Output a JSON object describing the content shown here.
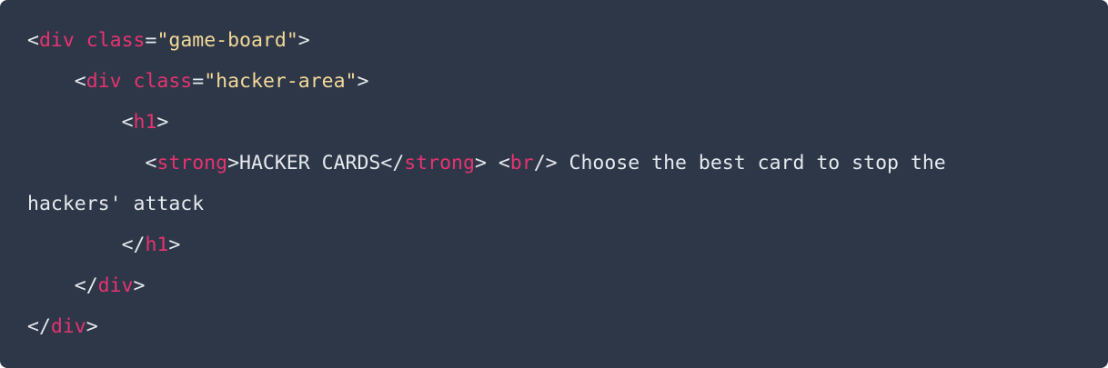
{
  "code": {
    "line1": {
      "open": "<",
      "tag": "div",
      "sp": " ",
      "attr": "class",
      "eq": "=",
      "value": "\"game-board\"",
      "close": ">"
    },
    "line2": {
      "indent": "    ",
      "open": "<",
      "tag": "div",
      "sp": " ",
      "attr": "class",
      "eq": "=",
      "value": "\"hacker-area\"",
      "close": ">"
    },
    "line3": {
      "indent": "        ",
      "open": "<",
      "tag": "h1",
      "close": ">"
    },
    "line4": {
      "indent": "          ",
      "open1": "<",
      "tag1": "strong",
      "close1": ">",
      "text1": "HACKER CARDS",
      "open2": "</",
      "tag2": "strong",
      "close2": ">",
      "sp": " ",
      "open3": "<",
      "tag3": "br",
      "close3": "/>",
      "text2": " Choose the best card to stop the"
    },
    "line5": {
      "text": "hackers' attack"
    },
    "line6": {
      "indent": "        ",
      "open": "</",
      "tag": "h1",
      "close": ">"
    },
    "line7": {
      "indent": "    ",
      "open": "</",
      "tag": "div",
      "close": ">"
    },
    "line8": {
      "open": "</",
      "tag": "div",
      "close": ">"
    }
  },
  "colors": {
    "background": "#2e3748",
    "tag": "#e6336f",
    "string": "#f3d999",
    "text": "#e6e9ee"
  }
}
